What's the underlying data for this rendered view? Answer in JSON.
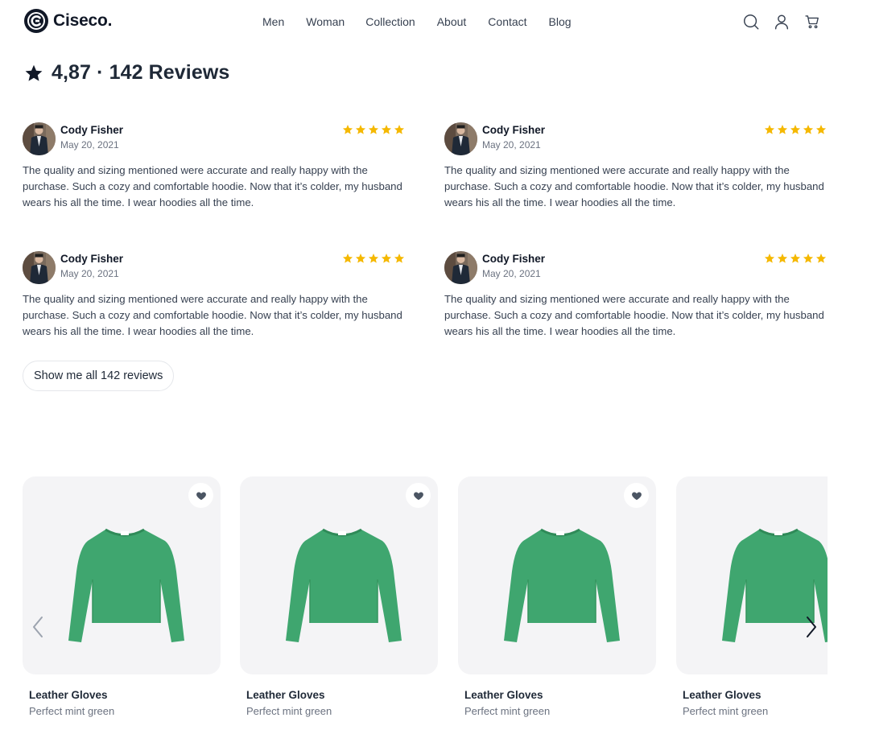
{
  "header": {
    "logo_text": "Ciseco.",
    "nav": [
      "Men",
      "Woman",
      "Collection",
      "About",
      "Contact",
      "Blog"
    ],
    "icons": [
      "search-icon",
      "user-icon",
      "cart-icon"
    ]
  },
  "summary": {
    "text": "4,87 · 142 Reviews",
    "rating": 4.87,
    "review_count": 142
  },
  "reviews": [
    {
      "name": "Cody Fisher",
      "date": "May 20, 2021",
      "stars": 5,
      "text": "The quality and sizing mentioned were accurate and really happy with the purchase. Such a cozy and comfortable hoodie. Now that it’s colder, my husband wears his all the time. I wear hoodies all the time."
    },
    {
      "name": "Cody Fisher",
      "date": "May 20, 2021",
      "stars": 5,
      "text": "The quality and sizing mentioned were accurate and really happy with the purchase. Such a cozy and comfortable hoodie. Now that it’s colder, my husband wears his all the time. I wear hoodies all the time."
    },
    {
      "name": "Cody Fisher",
      "date": "May 20, 2021",
      "stars": 5,
      "text": "The quality and sizing mentioned were accurate and really happy with the purchase. Such a cozy and comfortable hoodie. Now that it’s colder, my husband wears his all the time. I wear hoodies all the time."
    },
    {
      "name": "Cody Fisher",
      "date": "May 20, 2021",
      "stars": 5,
      "text": "The quality and sizing mentioned were accurate and really happy with the purchase. Such a cozy and comfortable hoodie. Now that it’s colder, my husband wears his all the time. I wear hoodies all the time."
    }
  ],
  "show_all_label": "Show me all 142 reviews",
  "products": [
    {
      "name": "Leather Gloves",
      "desc": "Perfect mint green"
    },
    {
      "name": "Leather Gloves",
      "desc": "Perfect mint green"
    },
    {
      "name": "Leather Gloves",
      "desc": "Perfect mint green"
    },
    {
      "name": "Leather Gloves",
      "desc": "Perfect mint green"
    }
  ],
  "colors": {
    "star": "#f5b800",
    "sweater": "#3fa66f",
    "card_bg": "#f4f4f6",
    "text_dark": "#1f2937",
    "text_muted": "#6b7280"
  }
}
